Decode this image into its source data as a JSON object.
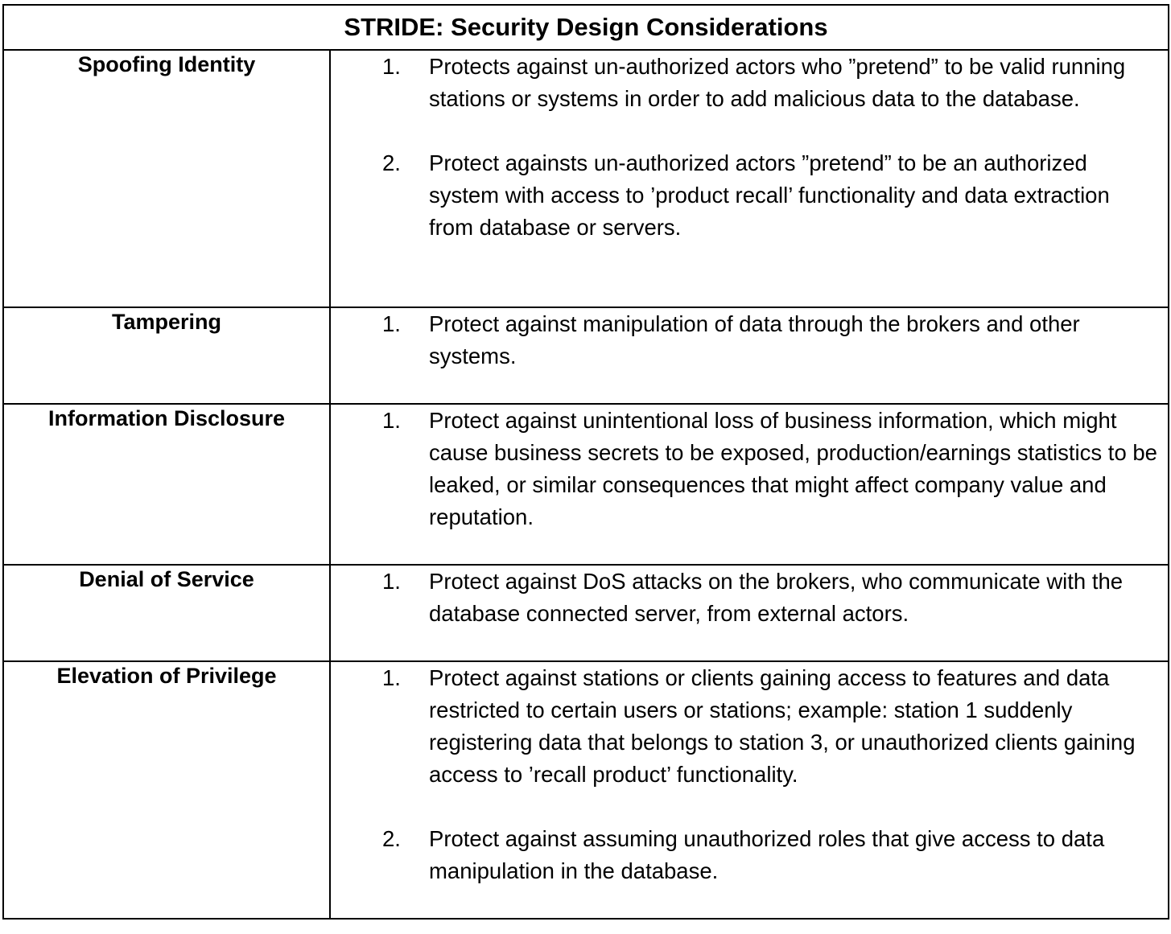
{
  "table": {
    "title": "STRIDE: Security Design Considerations",
    "rows": [
      {
        "threat": "Spoofing Identity",
        "items": [
          {
            "number": "1.",
            "text": "Protects against un-authorized actors who ”pretend” to be valid running stations or systems in order to add malicious data to the database."
          },
          {
            "number": "2.",
            "text": "Protect againsts un-authorized actors ”pretend” to be an authorized system with access to ’product recall’ functionality and data extraction from database or servers."
          }
        ]
      },
      {
        "threat": "Tampering",
        "items": [
          {
            "number": "1.",
            "text": "Protect against manipulation of data through the brokers and other systems."
          }
        ]
      },
      {
        "threat": "Information Disclosure",
        "items": [
          {
            "number": "1.",
            "text": "Protect against unintentional loss of business information, which might cause business secrets to be exposed, production/earnings statistics to be leaked, or similar consequences that might affect company value and reputation."
          }
        ]
      },
      {
        "threat": "Denial of Service",
        "items": [
          {
            "number": "1.",
            "text": "Protect against DoS attacks on the brokers, who communicate with the database connected server, from external actors."
          }
        ]
      },
      {
        "threat": "Elevation of Privilege",
        "items": [
          {
            "number": "1.",
            "text": "Protect against stations or clients gaining access to features and data restricted to certain users or stations; example: station 1 suddenly registering data that belongs to station 3, or unauthorized clients gaining access to ’recall product’ functionality."
          },
          {
            "number": "2.",
            "text": "Protect against assuming unauthorized roles that give access to data manipulation in the database."
          }
        ]
      }
    ]
  }
}
